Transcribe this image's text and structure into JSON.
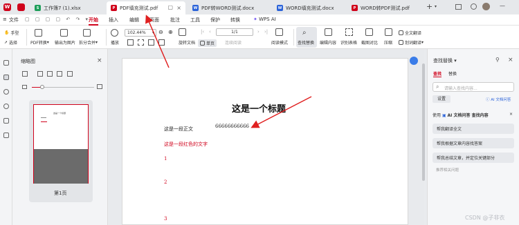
{
  "tabs": [
    {
      "label": "工作簿7 (1).xlsx",
      "color": "#1e9e5a",
      "glyph": "S"
    },
    {
      "label": "PDF填充测试.pdf",
      "color": "#d0021b",
      "glyph": "P"
    },
    {
      "label": "PDF转WORD测试.docx",
      "color": "#2b63d9",
      "glyph": "W"
    },
    {
      "label": "WORD填充测试.docx",
      "color": "#2b63d9",
      "glyph": "W"
    },
    {
      "label": "WORD转PDF测试.pdf",
      "color": "#d0021b",
      "glyph": "P"
    }
  ],
  "menu": {
    "file": "文件",
    "items": [
      "开始",
      "插入",
      "编辑",
      "页面",
      "批注",
      "工具",
      "保护",
      "转换"
    ],
    "wps_ai": "WPS AI"
  },
  "toolbar": {
    "hand": "手型",
    "select": "选择",
    "pdf_convert": "PDF转换",
    "export_image": "输出为图片",
    "split_merge": "拆分合并",
    "play": "播放",
    "zoom": "102.44%",
    "page_value": "1/1",
    "rotate": "旋转文档",
    "single_page": "单页",
    "continuous": "连续阅读",
    "read_mode": "阅读模式",
    "find_replace": "查找替换",
    "edit_content": "编辑内容",
    "ocr": "识别表格",
    "screenshot_compare": "截图对比",
    "compress": "压缩",
    "full_translate": "全文翻译",
    "word_translate": "划词翻译"
  },
  "thumbnail": {
    "title": "缩略图",
    "page_label": "第1页",
    "mini_title": "这是一个标题"
  },
  "document": {
    "title": "这是一个标题",
    "body_text": "这是一段正文",
    "number_text": "66666666666",
    "red_text": "这是一段红色的文字",
    "n1": "1",
    "n2": "2",
    "n3": "3"
  },
  "right_panel": {
    "title": "查找替换",
    "tab_find": "查找",
    "tab_replace": "替换",
    "search_placeholder": "请输入查找内容...",
    "settings": "设置",
    "ai_qa": "AI 文档问答",
    "ai_section_prefix": "使用",
    "ai_section_title": "AI 文档问答 查找内容",
    "suggestions": [
      "帮我翻译全文",
      "帮我根据文章内容找答案",
      "帮我总结文章，并定位关键部分"
    ],
    "recommend": "推荐相关问题"
  },
  "watermark": "CSDN @子非衣",
  "colors": {
    "accent": "#d0021b",
    "arrow": "#e02020",
    "ai_blue": "#2b63d9"
  }
}
